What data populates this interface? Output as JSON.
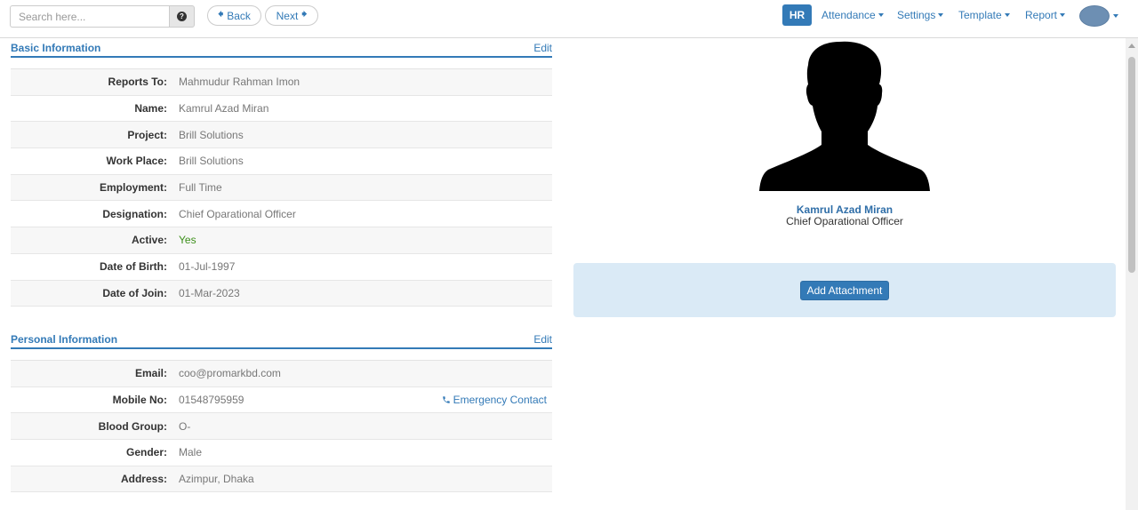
{
  "topbar": {
    "search_placeholder": "Search here...",
    "search_help_glyph": "?",
    "back_label": "Back",
    "next_label": "Next",
    "hr_label": "HR",
    "menu": [
      {
        "label": "Attendance"
      },
      {
        "label": "Settings"
      },
      {
        "label": "Template"
      },
      {
        "label": "Report"
      }
    ]
  },
  "basic_info": {
    "title": "Basic Information",
    "edit_label": "Edit",
    "rows": [
      {
        "label": "Reports To:",
        "value": "Mahmudur Rahman Imon"
      },
      {
        "label": "Name:",
        "value": "Kamrul Azad Miran"
      },
      {
        "label": "Project:",
        "value": "Brill Solutions"
      },
      {
        "label": "Work Place:",
        "value": "Brill Solutions"
      },
      {
        "label": "Employment:",
        "value": "Full Time"
      },
      {
        "label": "Designation:",
        "value": "Chief Oparational Officer"
      },
      {
        "label": "Active:",
        "value": "Yes"
      },
      {
        "label": "Date of Birth:",
        "value": "01-Jul-1997"
      },
      {
        "label": "Date of Join:",
        "value": "01-Mar-2023"
      }
    ]
  },
  "personal_info": {
    "title": "Personal Information",
    "edit_label": "Edit",
    "emergency_contact_label": "Emergency Contact",
    "rows": [
      {
        "label": "Email:",
        "value": "coo@promarkbd.com"
      },
      {
        "label": "Mobile No:",
        "value": "01548795959"
      },
      {
        "label": "Blood Group:",
        "value": "O-"
      },
      {
        "label": "Gender:",
        "value": "Male"
      },
      {
        "label": "Address:",
        "value": "Azimpur, Dhaka"
      }
    ]
  },
  "profile": {
    "name": "Kamrul Azad Miran",
    "designation": "Chief Oparational Officer",
    "add_attachment_label": "Add Attachment"
  },
  "colors": {
    "accent": "#337ab7",
    "active_green": "#3c8f1a",
    "attachment_panel": "#daeaf6"
  },
  "icons": {
    "back": "arrow-left-icon",
    "next": "arrow-right-icon",
    "help": "question-circle-icon",
    "phone": "phone-icon",
    "dropdown": "caret-down-icon"
  }
}
